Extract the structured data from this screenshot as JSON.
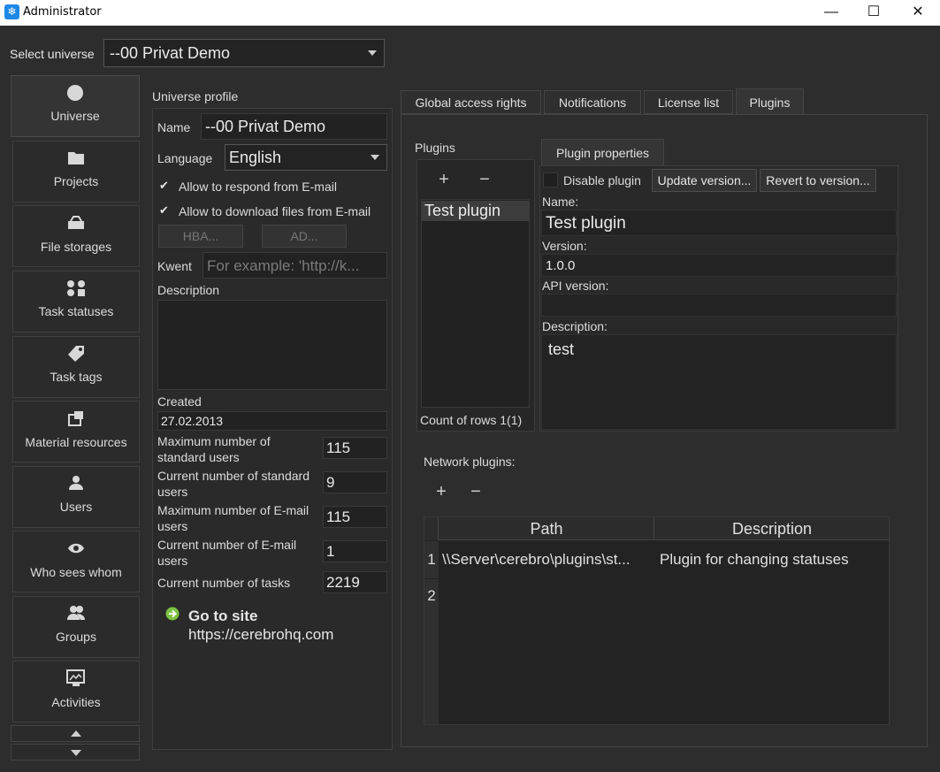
{
  "window": {
    "title": "Administrator"
  },
  "universe_select": {
    "label": "Select universe",
    "value": "--00 Privat Demo"
  },
  "nav": {
    "items": [
      {
        "label": "Universe",
        "icon": "circle-icon"
      },
      {
        "label": "Projects",
        "icon": "folder-icon"
      },
      {
        "label": "File storages",
        "icon": "storage-icon"
      },
      {
        "label": "Task statuses",
        "icon": "status-icon"
      },
      {
        "label": "Task tags",
        "icon": "tag-icon"
      },
      {
        "label": "Material resources",
        "icon": "resources-icon"
      },
      {
        "label": "Users",
        "icon": "user-icon"
      },
      {
        "label": "Who sees whom",
        "icon": "eye-icon"
      },
      {
        "label": "Groups",
        "icon": "group-icon"
      },
      {
        "label": "Activities",
        "icon": "activities-icon"
      }
    ]
  },
  "profile": {
    "title": "Universe profile",
    "name_label": "Name",
    "name_value": "--00 Privat Demo",
    "language_label": "Language",
    "language_value": "English",
    "respond_email": "Allow to respond from E-mail",
    "download_email": "Allow to download files from E-mail",
    "hba_button": "HBA...",
    "ad_button": "AD...",
    "kwent_label": "Kwent",
    "kwent_placeholder": "For example: 'http://k...",
    "description_label": "Description",
    "created_label": "Created",
    "created_value": "27.02.2013",
    "stats": [
      {
        "label": "Maximum number of standard users",
        "value": "115"
      },
      {
        "label": "Current number of standard users",
        "value": "9"
      },
      {
        "label": "Maximum number of E-mail users",
        "value": "115"
      },
      {
        "label": "Current number of E-mail users",
        "value": "1"
      },
      {
        "label": "Current number of tasks",
        "value": "2219"
      }
    ],
    "go_to_site": "Go to site",
    "site_url": "https://cerebrohq.com"
  },
  "tabs": [
    "Global access rights",
    "Notifications",
    "License list",
    "Plugins"
  ],
  "plugins": {
    "label": "Plugins",
    "add": "+",
    "remove": "−",
    "list": [
      "Test plugin"
    ],
    "count": "Count of rows 1(1)",
    "properties_tab": "Plugin properties",
    "disable_label": "Disable plugin",
    "update_button": "Update version...",
    "revert_button": "Revert to version...",
    "name_label": "Name:",
    "name_value": "Test plugin",
    "version_label": "Version:",
    "version_value": "1.0.0",
    "api_label": "API version:",
    "api_value": "",
    "desc_label": "Description:",
    "desc_value": "test"
  },
  "network": {
    "label": "Network plugins:",
    "add": "+",
    "remove": "−",
    "columns": [
      "Path",
      "Description"
    ],
    "rows": [
      {
        "num": "1",
        "path": "\\\\Server\\cerebro\\plugins\\st...",
        "description": "Plugin for changing statuses"
      },
      {
        "num": "2",
        "path": "",
        "description": ""
      }
    ]
  }
}
